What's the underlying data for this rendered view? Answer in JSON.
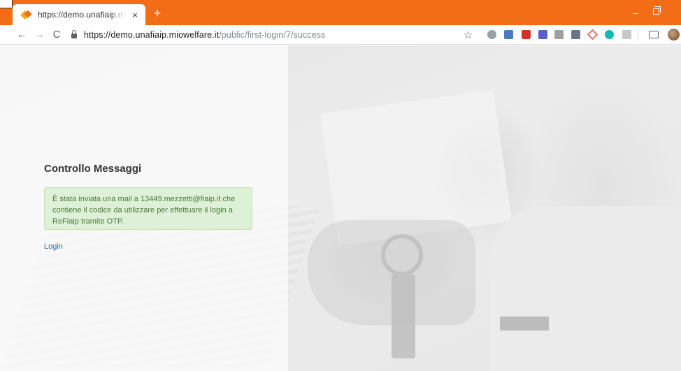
{
  "browser": {
    "tab": {
      "title": "https://demo.unafiaip.miowelfare",
      "close_glyph": "×"
    },
    "new_tab_glyph": "+",
    "window": {
      "minimize_glyph": "–"
    },
    "toolbar": {
      "back_glyph": "←",
      "forward_glyph": "→",
      "reload_glyph": "C",
      "url_host": "https://demo.unafiaip.miowelfare.it",
      "url_path": "/public/first-login/7/success",
      "star_glyph": "☆"
    },
    "extensions": [
      "globe-icon",
      "translate-icon",
      "lastpass-icon",
      "onenote-icon",
      "pdf-icon",
      "shield-icon",
      "diamond-icon",
      "circle-icon",
      "puzzle-icon",
      "cast-icon",
      "profile-avatar"
    ],
    "colors": {
      "tab_strip": "#f36d16",
      "alert_bg": "#dff0d8",
      "link": "#2a6fb0"
    }
  },
  "page": {
    "heading": "Controllo Messaggi",
    "alert_message": "È stata inviata una mail a 13449.mezzetti@fiaip.it che contiene il codice da utilizzare per effettuare il login a ReFiaip tramite OTP.",
    "login_link": "Login"
  }
}
